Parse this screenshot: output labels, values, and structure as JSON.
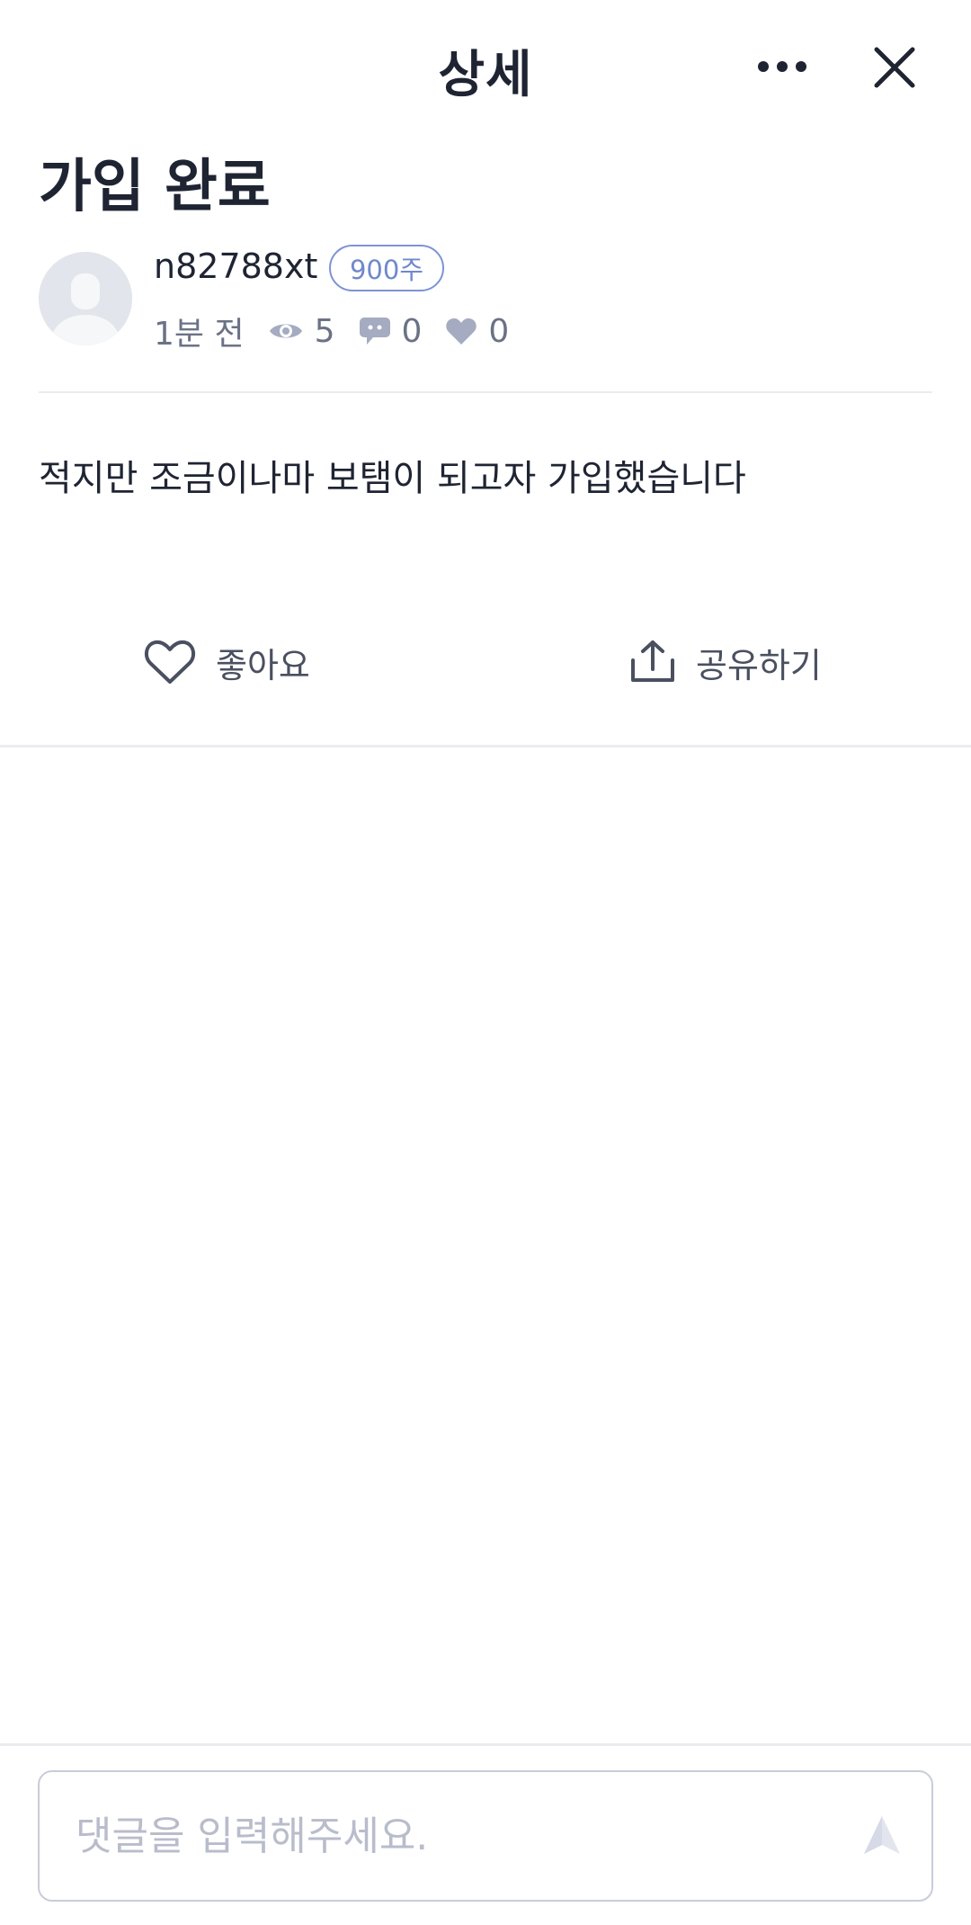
{
  "header": {
    "title": "상세",
    "more_icon": "more-horizontal-icon",
    "close_icon": "close-icon"
  },
  "post": {
    "title": "가입 완료",
    "author": {
      "name": "n82788xt",
      "badge": "900주"
    },
    "meta": {
      "time": "1분 전",
      "views": "5",
      "comments": "0",
      "likes": "0"
    },
    "body": "적지만 조금이나마 보탬이 되고자 가입했습니다"
  },
  "actions": {
    "like_label": "좋아요",
    "share_label": "공유하기"
  },
  "comment": {
    "placeholder": "댓글을 입력해주세요.",
    "value": ""
  },
  "colors": {
    "text": "#1f2433",
    "muted": "#6b7285",
    "badge": "#7088cc",
    "meta_icon": "#a5abc0",
    "divider": "#ececf0"
  }
}
